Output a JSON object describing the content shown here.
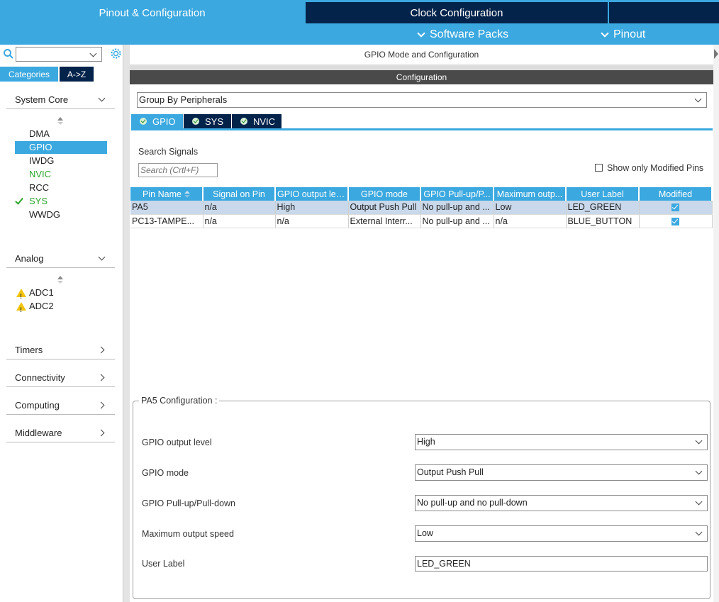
{
  "top_tabs": {
    "pinout": "Pinout & Configuration",
    "clock": "Clock Configuration"
  },
  "subnav": {
    "software_packs": "Software Packs",
    "pinout": "Pinout"
  },
  "left": {
    "category_tabs": [
      "Categories",
      "A->Z"
    ],
    "system_core": {
      "label": "System Core",
      "items": [
        "DMA",
        "GPIO",
        "IWDG",
        "NVIC",
        "RCC",
        "SYS",
        "WWDG"
      ]
    },
    "analog": {
      "label": "Analog",
      "items": [
        "ADC1",
        "ADC2"
      ]
    },
    "collapsed_sections": [
      "Timers",
      "Connectivity",
      "Computing",
      "Middleware"
    ]
  },
  "main": {
    "title": "GPIO Mode and Configuration",
    "config_header": "Configuration",
    "group_by": "Group By Peripherals",
    "tabs": [
      "GPIO",
      "SYS",
      "NVIC"
    ],
    "search_label": "Search Signals",
    "search_placeholder": "Search (Crtl+F)",
    "show_modified_label": "Show only Modified Pins",
    "table": {
      "headers": [
        "Pin Name",
        "Signal on Pin",
        "GPIO output level",
        "GPIO mode",
        "GPIO Pull-up/P...",
        "Maximum outp...",
        "User Label",
        "Modified"
      ],
      "rows": [
        [
          "PA5",
          "n/a",
          "High",
          "Output Push Pull",
          "No pull-up and ...",
          "Low",
          "LED_GREEN"
        ],
        [
          "PC13-TAMPE...",
          "n/a",
          "n/a",
          "External Interr...",
          "No pull-up and ...",
          "n/a",
          "BLUE_BUTTON"
        ]
      ]
    },
    "pa5_config": {
      "legend": "PA5 Configuration :",
      "fields": [
        {
          "label": "GPIO output level",
          "value": "High"
        },
        {
          "label": "GPIO mode",
          "value": "Output Push Pull"
        },
        {
          "label": "GPIO Pull-up/Pull-down",
          "value": "No pull-up and no pull-down"
        },
        {
          "label": "Maximum output speed",
          "value": "Low"
        },
        {
          "label": "User Label",
          "value": "LED_GREEN"
        }
      ]
    }
  },
  "colors": {
    "accent": "#3ba8df",
    "navy": "#03234b",
    "ok_green": "#2aa52a",
    "warning": "#f1c40f"
  }
}
